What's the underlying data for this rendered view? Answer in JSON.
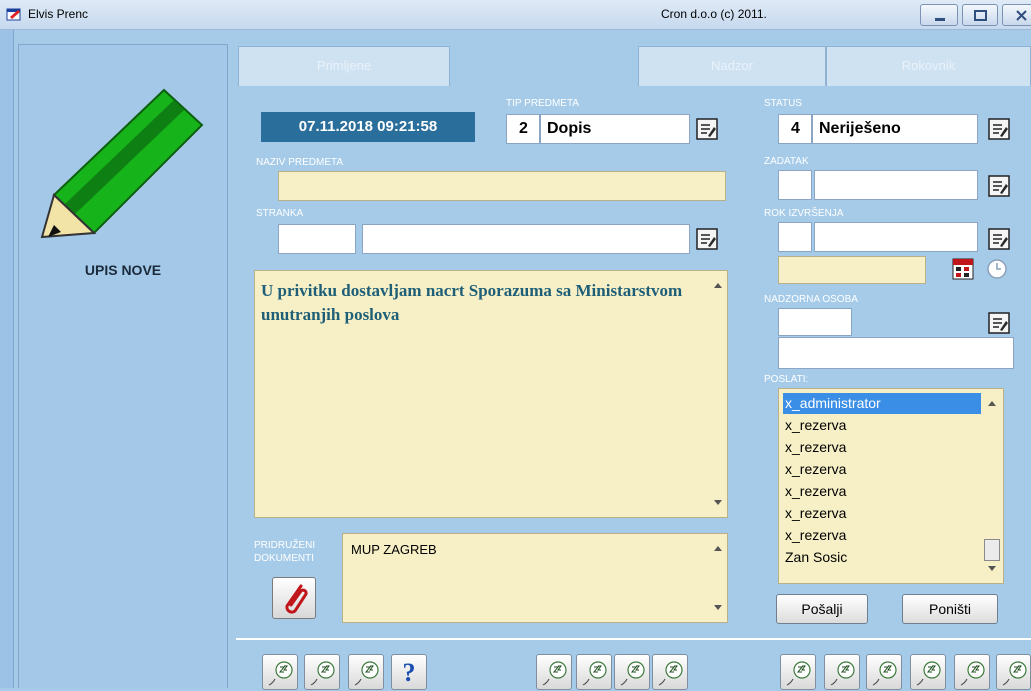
{
  "window": {
    "title": "Elvis Prenc",
    "company": "Cron d.o.o (c) 2011."
  },
  "sidebar": {
    "mode_label": "UPIS NOVE"
  },
  "tabs": [
    {
      "label": "Primljene"
    },
    {
      "label": ""
    },
    {
      "label": "Nadzor"
    },
    {
      "label": "Rokovnik"
    }
  ],
  "form": {
    "datetime": "07.11.2018 09:21:58",
    "tip_predmeta": {
      "label": "TIP PREDMETA",
      "code": "2",
      "value": "Dopis"
    },
    "status": {
      "label": "STATUS",
      "code": "4",
      "value": "Neriješeno"
    },
    "naziv": {
      "label": "NAZIV PREDMETA",
      "value": ""
    },
    "zadatak": {
      "label": "ZADATAK",
      "code": "",
      "value": ""
    },
    "stranka": {
      "label": "STRANKA",
      "code": "",
      "value": ""
    },
    "rok": {
      "label": "ROK IZVRŠENJA",
      "code": "",
      "value": "",
      "date": ""
    },
    "nadzorna": {
      "label": "NADZORNA OSOBA",
      "code": "",
      "value": ""
    },
    "body_text": "U privitku dostavljam nacrt Sporazuma sa Ministarstvom unutranjih poslova",
    "pridruzeni": {
      "label_line1": "PRIDRUŽENI",
      "label_line2": "DOKUMENTI",
      "value": "MUP ZAGREB"
    },
    "poslati": {
      "label": "POSLATI:",
      "items": [
        "x_administrator",
        "x_rezerva",
        "x_rezerva",
        "x_rezerva",
        "x_rezerva",
        "x_rezerva",
        "x_rezerva",
        "Zan Sosic"
      ],
      "selected_index": 0
    }
  },
  "buttons": {
    "send": "Pošalji",
    "cancel": "Poništi",
    "help": "?"
  },
  "colors": {
    "background": "#a6cbe9",
    "field_yellow": "#f7f0c7",
    "date_box": "#2a6e9b",
    "selection": "#3b8ee6",
    "body_text": "#1e5f77"
  }
}
